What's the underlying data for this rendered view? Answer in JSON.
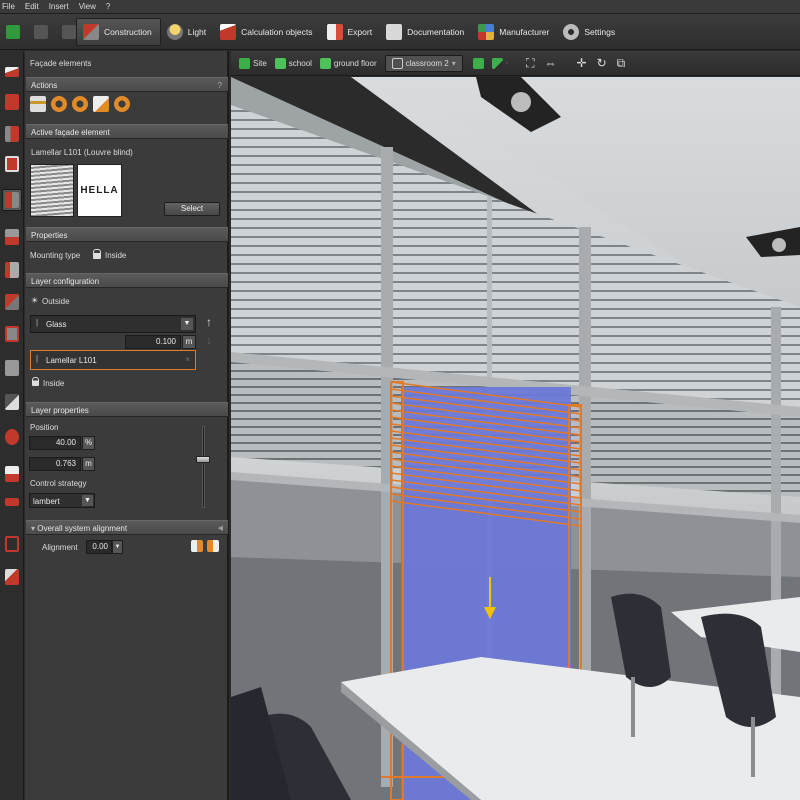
{
  "menu": [
    "File",
    "Edit",
    "Insert",
    "View",
    "?"
  ],
  "toolbar": {
    "tabs": [
      {
        "label": "Construction",
        "icon": "construction-icon",
        "color": "#c0392b",
        "active": true
      },
      {
        "label": "Light",
        "icon": "light-icon",
        "color": "#e0b040"
      },
      {
        "label": "Calculation objects",
        "icon": "calculation-objects-icon",
        "color": "#c0392b"
      },
      {
        "label": "Export",
        "icon": "export-icon",
        "color": "#d94c3a"
      },
      {
        "label": "Documentation",
        "icon": "documentation-icon",
        "color": "#cccccc"
      },
      {
        "label": "Manufacturer",
        "icon": "manufacturer-icon",
        "color": "#4a7fd0"
      },
      {
        "label": "Settings",
        "icon": "gear-icon",
        "color": "#bbbbbb"
      }
    ]
  },
  "breadcrumb": [
    {
      "label": "Site",
      "icon": "site-icon"
    },
    {
      "label": "school",
      "icon": "building-icon"
    },
    {
      "label": "ground floor",
      "icon": "floor-icon"
    },
    {
      "label": "classroom 2",
      "icon": "room-icon"
    }
  ],
  "panel": {
    "title": "Façade elements",
    "actions": {
      "title": "Actions",
      "help": "?"
    },
    "active_element": {
      "title": "Active façade element",
      "name": "Lamellar L101 (Louvre blind)",
      "brand": "HELLA",
      "select_label": "Select"
    },
    "properties": {
      "title": "Properties",
      "mounting_label": "Mounting type",
      "mounting_value": "Inside"
    },
    "layer_config": {
      "title": "Layer configuration",
      "outside_label": "Outside",
      "glass_label": "Glass",
      "glass_thickness": "0.100",
      "glass_unit": "m",
      "lamellar_label": "Lamellar L101",
      "inside_label": "Inside"
    },
    "layer_properties": {
      "title": "Layer properties",
      "position_label": "Position",
      "position_pct": "40.00",
      "position_pct_unit": "%",
      "position_m": "0.763",
      "position_m_unit": "m",
      "control_label": "Control strategy",
      "control_value": "lambert",
      "slider_level": 0.4
    },
    "alignment": {
      "title": "Overall system alignment",
      "label": "Alignment",
      "value": "0.00"
    }
  },
  "colors": {
    "accent": "#e07a2a",
    "panel": "#3b3b3b",
    "selection": "#6b78d6"
  }
}
